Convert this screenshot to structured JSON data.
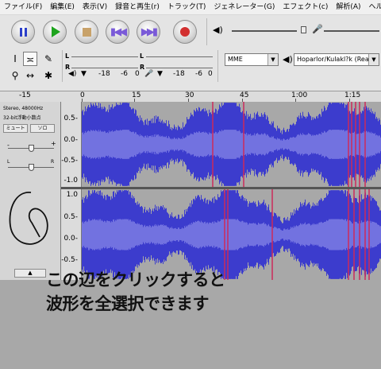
{
  "menu": [
    "ファイル(F)",
    "編集(E)",
    "表示(V)",
    "録音と再生(r)",
    "トラック(T)",
    "ジェネレーター(G)",
    "エフェクト(c)",
    "解析(A)",
    "ヘル"
  ],
  "transport": {
    "pause": "pause",
    "play": "play",
    "stop": "stop",
    "skip_start": "skip-to-start",
    "skip_end": "skip-to-end",
    "record": "record"
  },
  "meters": {
    "channel_l": "L",
    "channel_r": "R",
    "scale_1": "-18",
    "scale_2": "-6",
    "scale_3": "0",
    "scale_4": "-18",
    "scale_5": "-6",
    "scale_6": "0"
  },
  "devices": {
    "host": "MME",
    "output": "Hoparlor/Kulakl?k (Realt"
  },
  "timeline": {
    "ticks": [
      {
        "label": "-15"
      },
      {
        "label": "0"
      },
      {
        "label": "15"
      },
      {
        "label": "30"
      },
      {
        "label": "45"
      },
      {
        "label": "1:00"
      },
      {
        "label": "1:15"
      }
    ]
  },
  "track": {
    "info_line1": "Stereo, 48000Hz",
    "info_line2": "32-bit浮動小数点",
    "mute": "ミュート",
    "solo": "ソロ",
    "gain_minus": "-",
    "gain_plus": "+",
    "pan_left": "L",
    "pan_right": "R",
    "collapse_arrow": "▲"
  },
  "scale_top": [
    "0.5-",
    "0.0-",
    "-0.5-",
    "-1.0"
  ],
  "scale_bottom": [
    "1.0",
    "0.5-",
    "0.0-",
    "-0.5-"
  ],
  "caption": {
    "line1": "この辺をクリックすると",
    "line2": "波形を全選択できます"
  },
  "colors": {
    "wave": "#3c3ccd",
    "wave_light": "#7272e0",
    "selection": "#a8a8a8",
    "clip": "#cc2a5a"
  }
}
